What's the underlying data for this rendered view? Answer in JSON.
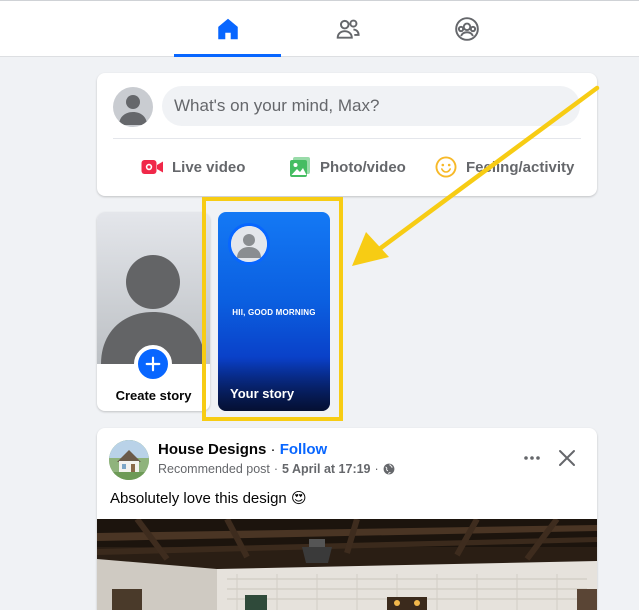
{
  "nav": {
    "tabs": [
      {
        "name": "home",
        "active": true
      },
      {
        "name": "friends",
        "active": false
      },
      {
        "name": "groups",
        "active": false
      }
    ],
    "accent": "#0866ff"
  },
  "composer": {
    "placeholder": "What's on your mind, Max?",
    "actions": {
      "live_video": "Live video",
      "photo_video": "Photo/video",
      "feeling": "Feeling/activity"
    }
  },
  "stories": {
    "create_label": "Create story",
    "your_story_label": "Your story",
    "your_story_text": "HII, GOOD MORNING",
    "highlight_color": "#f7cc14"
  },
  "post": {
    "author": "House Designs",
    "separator": " · ",
    "follow_label": "Follow",
    "recommended": "Recommended post",
    "meta_separator": "·",
    "date": "5 April at 17:19",
    "text": "Absolutely love this design 😍",
    "icons": [
      "more-icon",
      "close-icon",
      "globe-icon"
    ]
  }
}
